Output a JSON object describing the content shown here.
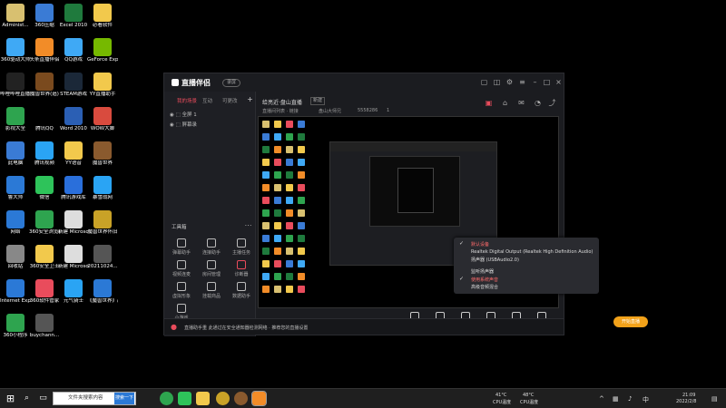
{
  "desktop_icons": [
    {
      "label": "Administ...",
      "color": "#d8c070"
    },
    {
      "label": "360压缩",
      "color": "#3a7bd5"
    },
    {
      "label": "Excel 2010",
      "color": "#1f7a3d"
    },
    {
      "label": "必看软件",
      "color": "#f2c94c"
    },
    {
      "label": "360驱动大师",
      "color": "#3fa9f5"
    },
    {
      "label": "头条直播伴侣",
      "color": "#f28c28"
    },
    {
      "label": "QQ游戏",
      "color": "#3fa9f5"
    },
    {
      "label": "GeForce Experience",
      "color": "#76b900"
    },
    {
      "label": "哔哩哔哩直播姬",
      "color": "#222"
    },
    {
      "label": "魔兽世界(追)",
      "color": "#7a4a1e"
    },
    {
      "label": "STEAM游戏",
      "color": "#1b2838"
    },
    {
      "label": "YY直播助手",
      "color": "#f2c94c"
    },
    {
      "label": "影视大全",
      "color": "#2ea44f"
    },
    {
      "label": "腾讯QQ",
      "color": "#000"
    },
    {
      "label": "Word 2010",
      "color": "#2b5fb4"
    },
    {
      "label": "WOW大脚",
      "color": "#d94b3e"
    },
    {
      "label": "此电脑",
      "color": "#3a7bd5"
    },
    {
      "label": "腾讯视频",
      "color": "#2aa4f4"
    },
    {
      "label": "YY语音",
      "color": "#f2c94c"
    },
    {
      "label": "魔兽世界",
      "color": "#8a5a2e"
    },
    {
      "label": "鲁大师",
      "color": "#2b79d6"
    },
    {
      "label": "微信",
      "color": "#2ec35a"
    },
    {
      "label": "腾讯游戏库",
      "color": "#2a6fdb"
    },
    {
      "label": "暴雪战网",
      "color": "#2aa4f4"
    },
    {
      "label": "网络",
      "color": "#2b79d6"
    },
    {
      "label": "360安全浏览器",
      "color": "#2ea44f"
    },
    {
      "label": "新建 Microsoft...",
      "color": "#ddd"
    },
    {
      "label": "魔兽世界怀旧",
      "color": "#c9a227"
    },
    {
      "label": "回收站",
      "color": "#888"
    },
    {
      "label": "360安全卫士",
      "color": "#f2c94c"
    },
    {
      "label": "新建 Microsoft...",
      "color": "#ddd"
    },
    {
      "label": "20211024...",
      "color": "#555"
    },
    {
      "label": "Internet Explorer",
      "color": "#2b79d6"
    },
    {
      "label": "360软件管家",
      "color": "#e94c5c"
    },
    {
      "label": "元气骑士",
      "color": "#2aa4f4"
    },
    {
      "label": "《魔兽世界》战网(怀旧)",
      "color": "#2b79d6"
    },
    {
      "label": "360小程序",
      "color": "#2ea44f"
    },
    {
      "label": "buychann...",
      "color": "#555"
    }
  ],
  "app": {
    "name": "直播伴侣",
    "badge": "录屏",
    "left_tabs": [
      "我的场景",
      "互动",
      "可更改"
    ],
    "scenes": [
      "全屏 1",
      "屏幕录"
    ],
    "tools_title": "工具箱",
    "tools": [
      "弹幕助手",
      "连接助手",
      "主播任务",
      "视频连麦",
      "房间管理",
      "诊断器",
      "虚拟形象",
      "挂载商品",
      "数据助手",
      "小游戏"
    ],
    "stream_title": "给亮近·盘山直播",
    "stream_tag": "新建",
    "stream_info": [
      "直播间列表 · 链接",
      "盘山大师兄",
      "5558286",
      "1"
    ],
    "bottom_buttons": [
      "直播屏幕",
      "摄像头",
      "手机投屏",
      "多媒体",
      "麦克风",
      "扬声器"
    ],
    "start_live": "开始直播",
    "status_text": "直播助手重 此通过在安全通知器检测网络 · 推荐您的直播设置"
  },
  "audio_menu": {
    "items": [
      {
        "text": "默认设备",
        "checked": true,
        "red": true
      },
      {
        "text": "Realtek Digital Output (Realtek High Definition Audio)",
        "checked": false,
        "red": false
      },
      {
        "text": "扬声器 (USBAudio2.0)",
        "checked": false,
        "red": false
      },
      {
        "text": "监听扬声器",
        "checked": false,
        "red": false
      },
      {
        "text": "使用系统声音",
        "checked": true,
        "red": true
      },
      {
        "text": "高级音频混合",
        "checked": false,
        "red": false
      }
    ]
  },
  "taskbar": {
    "search_placeholder": "文件夹搜索内容",
    "search_button": "搜索一下",
    "weather1": "41°C",
    "weather1_label": "CPU温度",
    "weather2": "48°C",
    "weather2_label": "CPU温度",
    "time": "21:09",
    "date": "2022/2/8"
  }
}
